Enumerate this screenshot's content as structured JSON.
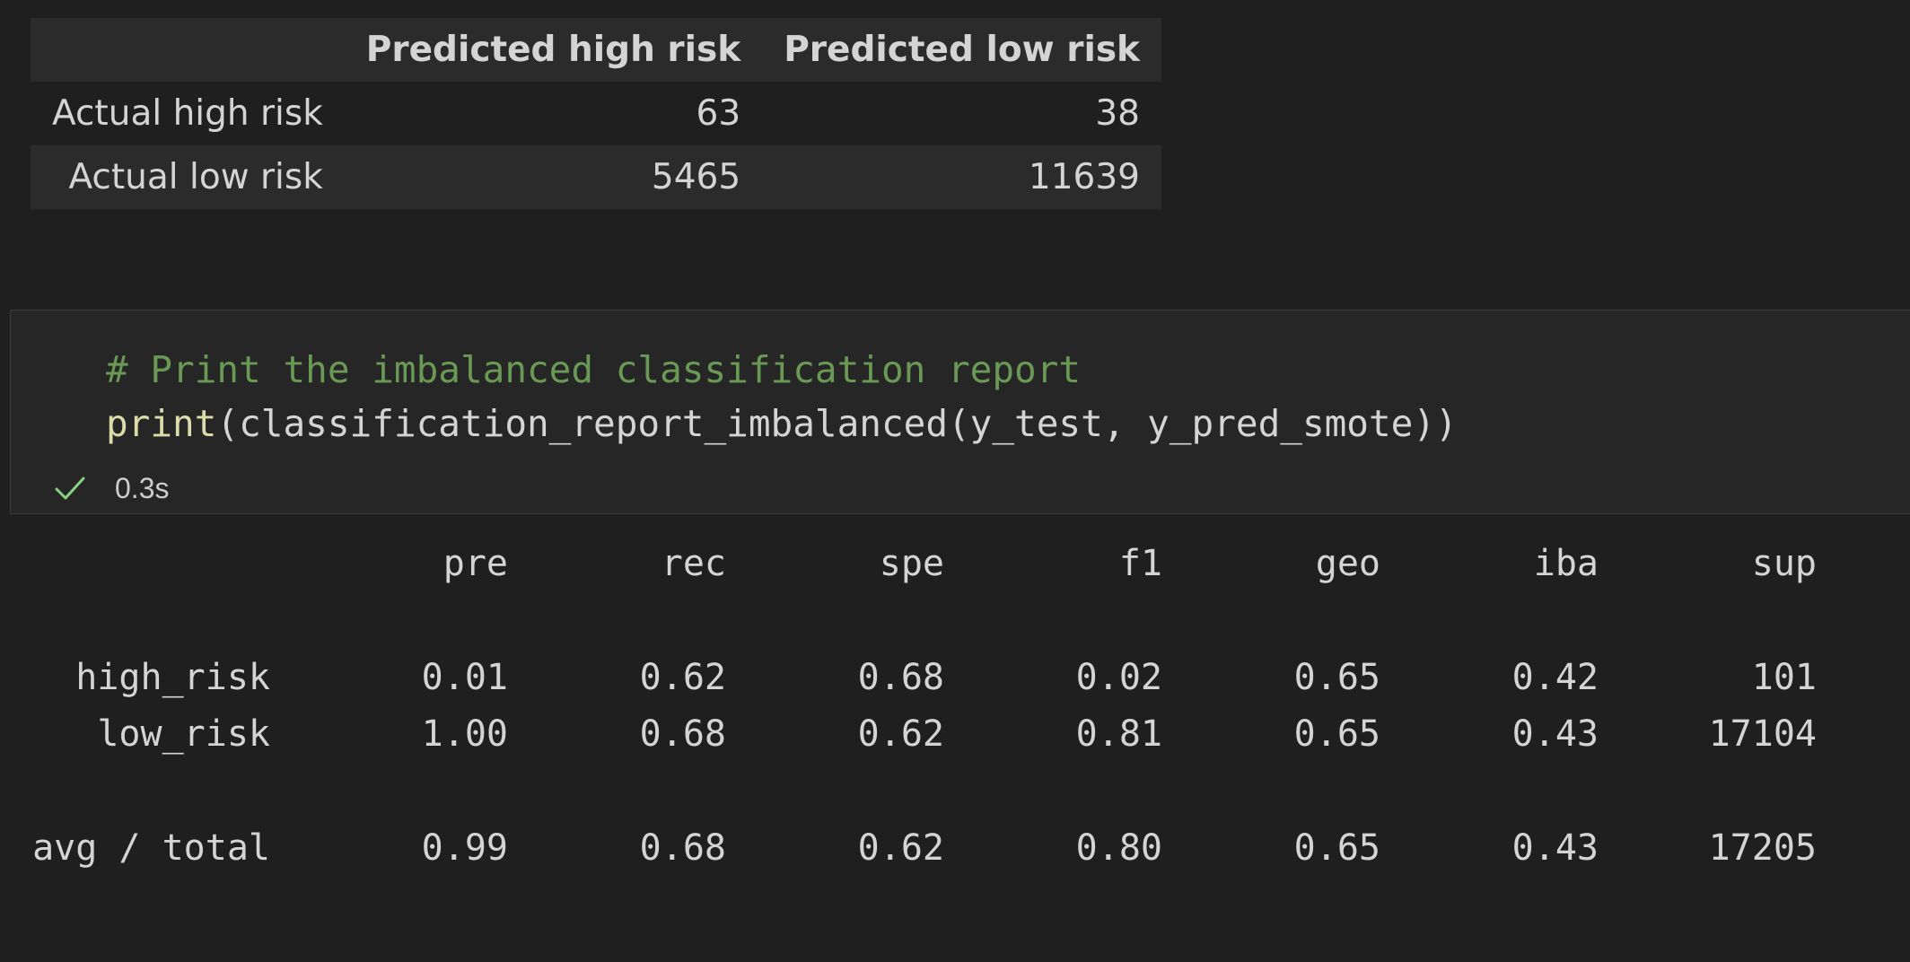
{
  "confusion_matrix": {
    "columns": [
      "",
      "Predicted high risk",
      "Predicted low risk"
    ],
    "rows": [
      {
        "label": "Actual high risk",
        "values": [
          "63",
          "38"
        ]
      },
      {
        "label": "Actual low risk",
        "values": [
          "5465",
          "11639"
        ]
      }
    ]
  },
  "code_cell": {
    "comment": "# Print the imbalanced classification report",
    "func": "print",
    "args": "(classification_report_imbalanced(y_test, y_pred_smote))",
    "status_icon": "check-icon",
    "exec_time": "0.3s",
    "success_color": "#89d185"
  },
  "report": {
    "headers": [
      "pre",
      "rec",
      "spe",
      "f1",
      "geo",
      "iba",
      "sup"
    ],
    "rows": [
      {
        "label": "high_risk",
        "values": [
          "0.01",
          "0.62",
          "0.68",
          "0.02",
          "0.65",
          "0.42",
          "101"
        ]
      },
      {
        "label": "low_risk",
        "values": [
          "1.00",
          "0.68",
          "0.62",
          "0.81",
          "0.65",
          "0.43",
          "17104"
        ]
      },
      {
        "label": "avg / total",
        "values": [
          "0.99",
          "0.68",
          "0.62",
          "0.80",
          "0.65",
          "0.43",
          "17205"
        ]
      }
    ]
  }
}
